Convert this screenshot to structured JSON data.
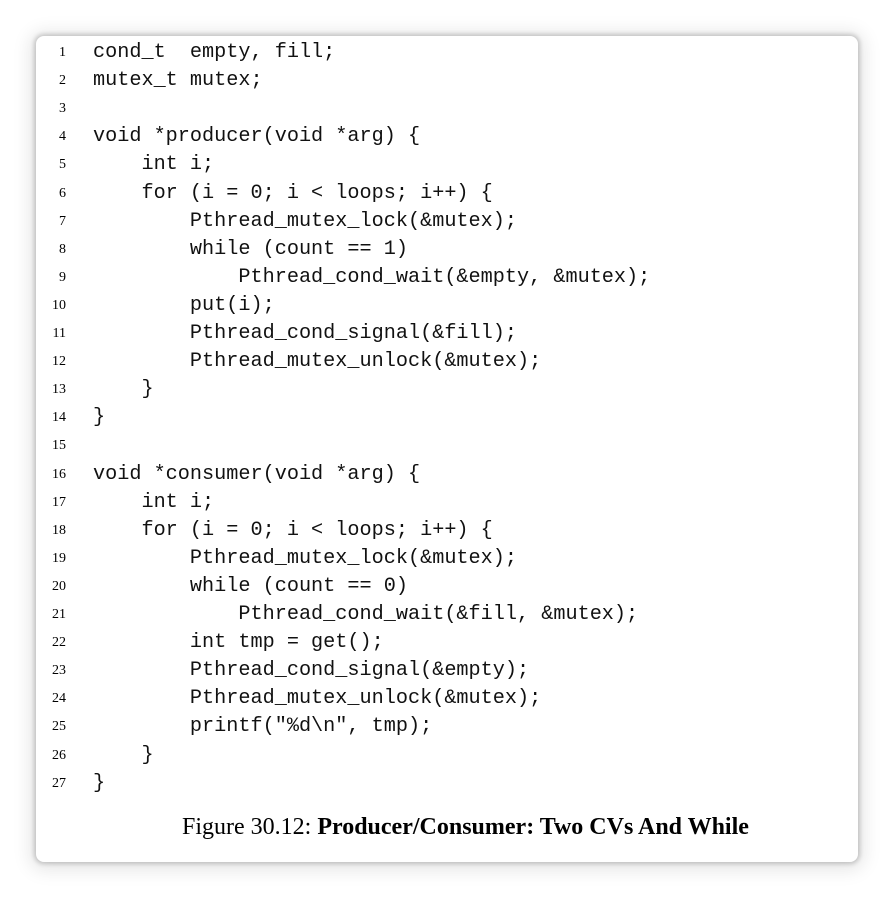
{
  "code_lines": [
    {
      "num": "1",
      "text": "cond_t  empty, fill;"
    },
    {
      "num": "2",
      "text": "mutex_t mutex;"
    },
    {
      "num": "3",
      "text": ""
    },
    {
      "num": "4",
      "text": "void *producer(void *arg) {"
    },
    {
      "num": "5",
      "text": "    int i;"
    },
    {
      "num": "6",
      "text": "    for (i = 0; i < loops; i++) {"
    },
    {
      "num": "7",
      "text": "        Pthread_mutex_lock(&mutex);"
    },
    {
      "num": "8",
      "text": "        while (count == 1)"
    },
    {
      "num": "9",
      "text": "            Pthread_cond_wait(&empty, &mutex);"
    },
    {
      "num": "10",
      "text": "        put(i);"
    },
    {
      "num": "11",
      "text": "        Pthread_cond_signal(&fill);"
    },
    {
      "num": "12",
      "text": "        Pthread_mutex_unlock(&mutex);"
    },
    {
      "num": "13",
      "text": "    }"
    },
    {
      "num": "14",
      "text": "}"
    },
    {
      "num": "15",
      "text": ""
    },
    {
      "num": "16",
      "text": "void *consumer(void *arg) {"
    },
    {
      "num": "17",
      "text": "    int i;"
    },
    {
      "num": "18",
      "text": "    for (i = 0; i < loops; i++) {"
    },
    {
      "num": "19",
      "text": "        Pthread_mutex_lock(&mutex);"
    },
    {
      "num": "20",
      "text": "        while (count == 0)"
    },
    {
      "num": "21",
      "text": "            Pthread_cond_wait(&fill, &mutex);"
    },
    {
      "num": "22",
      "text": "        int tmp = get();"
    },
    {
      "num": "23",
      "text": "        Pthread_cond_signal(&empty);"
    },
    {
      "num": "24",
      "text": "        Pthread_mutex_unlock(&mutex);"
    },
    {
      "num": "25",
      "text": "        printf(\"%d\\n\", tmp);"
    },
    {
      "num": "26",
      "text": "    }"
    },
    {
      "num": "27",
      "text": "}"
    }
  ],
  "caption": {
    "label": "Figure 30.12: ",
    "title": "Producer/Consumer: Two CVs And While"
  }
}
